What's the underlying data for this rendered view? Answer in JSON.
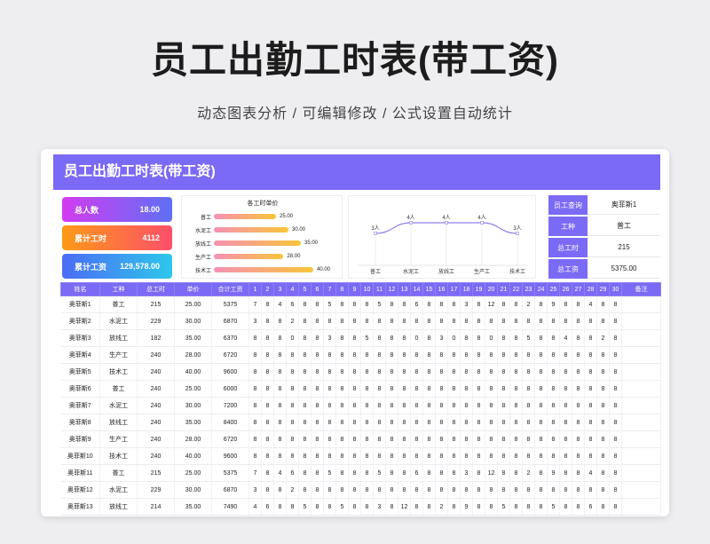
{
  "header": {
    "title": "员工出勤工时表(带工资)",
    "subtitle": "动态图表分析 /  可编辑修改  / 公式设置自动统计"
  },
  "banner": "员工出勤工时表(带工资)",
  "kpis": [
    {
      "label": "总人数",
      "value": "18.00",
      "gradient": [
        "#d33cf0",
        "#5e6ff5"
      ]
    },
    {
      "label": "累计工时",
      "value": "4112",
      "gradient": [
        "#fc9a16",
        "#fc4f6a"
      ]
    },
    {
      "label": "累计工资",
      "value": "129,578.00",
      "gradient": [
        "#4b6cf5",
        "#2ec7eb"
      ]
    }
  ],
  "chart_data": [
    {
      "type": "bar",
      "title": "各工时单价",
      "categories": [
        "普工",
        "水泥工",
        "放线工",
        "生产工",
        "技术工"
      ],
      "values": [
        25,
        30,
        35,
        28,
        40
      ],
      "labels": [
        "25.00",
        "30.00",
        "35.00",
        "28.00",
        "40.00"
      ]
    },
    {
      "type": "line",
      "categories": [
        "普工",
        "水泥工",
        "放线工",
        "生产工",
        "技术工"
      ],
      "values": [
        3,
        4,
        4,
        4,
        3
      ],
      "labels": [
        "3人",
        "4人",
        "4人",
        "4人",
        "3人"
      ],
      "ylim": [
        0,
        5
      ]
    }
  ],
  "info": [
    {
      "k": "员工查询",
      "v": "奥菲斯1"
    },
    {
      "k": "工种",
      "v": "普工"
    },
    {
      "k": "总工时",
      "v": "215"
    },
    {
      "k": "总工资",
      "v": "5375.00"
    }
  ],
  "table": {
    "headers": [
      "姓名",
      "工种",
      "总工时",
      "单价",
      "合计工资",
      "1",
      "2",
      "3",
      "4",
      "5",
      "6",
      "7",
      "8",
      "9",
      "10",
      "11",
      "12",
      "13",
      "14",
      "15",
      "16",
      "17",
      "18",
      "19",
      "20",
      "21",
      "22",
      "23",
      "24",
      "25",
      "26",
      "27",
      "28",
      "29",
      "30",
      "备注"
    ],
    "rows": [
      [
        "奥菲斯1",
        "普工",
        "215",
        "25.00",
        "5375",
        "7",
        "8",
        "4",
        "6",
        "8",
        "8",
        "5",
        "8",
        "8",
        "8",
        "5",
        "8",
        "8",
        "6",
        "8",
        "8",
        "8",
        "3",
        "8",
        "12",
        "8",
        "8",
        "2",
        "8",
        "9",
        "8",
        "8",
        "4",
        "8",
        "8",
        ""
      ],
      [
        "奥菲斯2",
        "水泥工",
        "229",
        "30.00",
        "6870",
        "3",
        "8",
        "8",
        "2",
        "8",
        "8",
        "8",
        "8",
        "8",
        "8",
        "8",
        "8",
        "8",
        "8",
        "8",
        "8",
        "8",
        "8",
        "8",
        "8",
        "8",
        "8",
        "8",
        "8",
        "8",
        "8",
        "8",
        "8",
        "8",
        "8",
        ""
      ],
      [
        "奥菲斯3",
        "放线工",
        "182",
        "35.00",
        "6370",
        "8",
        "8",
        "8",
        "0",
        "8",
        "8",
        "3",
        "8",
        "8",
        "5",
        "8",
        "8",
        "8",
        "0",
        "8",
        "3",
        "0",
        "8",
        "8",
        "0",
        "8",
        "8",
        "5",
        "8",
        "8",
        "4",
        "8",
        "8",
        "2",
        "8",
        ""
      ],
      [
        "奥菲斯4",
        "生产工",
        "240",
        "28.00",
        "6720",
        "8",
        "8",
        "8",
        "8",
        "8",
        "8",
        "8",
        "8",
        "8",
        "8",
        "8",
        "8",
        "8",
        "8",
        "8",
        "8",
        "8",
        "8",
        "8",
        "8",
        "8",
        "8",
        "8",
        "8",
        "8",
        "8",
        "8",
        "8",
        "8",
        "8",
        ""
      ],
      [
        "奥菲斯5",
        "技术工",
        "240",
        "40.00",
        "9600",
        "8",
        "8",
        "8",
        "8",
        "8",
        "8",
        "8",
        "8",
        "8",
        "8",
        "8",
        "8",
        "8",
        "8",
        "8",
        "8",
        "8",
        "8",
        "8",
        "8",
        "8",
        "8",
        "8",
        "8",
        "8",
        "8",
        "8",
        "8",
        "8",
        "8",
        ""
      ],
      [
        "奥菲斯6",
        "普工",
        "240",
        "25.00",
        "6000",
        "8",
        "8",
        "8",
        "8",
        "8",
        "8",
        "8",
        "8",
        "8",
        "8",
        "8",
        "8",
        "8",
        "8",
        "8",
        "8",
        "8",
        "8",
        "8",
        "8",
        "8",
        "8",
        "8",
        "8",
        "8",
        "8",
        "8",
        "8",
        "8",
        "8",
        ""
      ],
      [
        "奥菲斯7",
        "水泥工",
        "240",
        "30.00",
        "7200",
        "8",
        "8",
        "8",
        "8",
        "8",
        "8",
        "8",
        "8",
        "8",
        "8",
        "8",
        "8",
        "8",
        "8",
        "8",
        "8",
        "8",
        "8",
        "8",
        "8",
        "8",
        "8",
        "8",
        "8",
        "8",
        "8",
        "8",
        "8",
        "8",
        "8",
        ""
      ],
      [
        "奥菲斯8",
        "放线工",
        "240",
        "35.00",
        "8400",
        "8",
        "8",
        "8",
        "8",
        "8",
        "8",
        "8",
        "8",
        "8",
        "8",
        "8",
        "8",
        "8",
        "8",
        "8",
        "8",
        "8",
        "8",
        "8",
        "8",
        "8",
        "8",
        "8",
        "8",
        "8",
        "8",
        "8",
        "8",
        "8",
        "8",
        ""
      ],
      [
        "奥菲斯9",
        "生产工",
        "240",
        "28.00",
        "6720",
        "8",
        "8",
        "8",
        "8",
        "8",
        "8",
        "8",
        "8",
        "8",
        "8",
        "8",
        "8",
        "8",
        "8",
        "8",
        "8",
        "8",
        "8",
        "8",
        "8",
        "8",
        "8",
        "8",
        "8",
        "8",
        "8",
        "8",
        "8",
        "8",
        "8",
        ""
      ],
      [
        "奥菲斯10",
        "技术工",
        "240",
        "40.00",
        "9600",
        "8",
        "8",
        "8",
        "8",
        "8",
        "8",
        "8",
        "8",
        "8",
        "8",
        "8",
        "8",
        "8",
        "8",
        "8",
        "8",
        "8",
        "8",
        "8",
        "8",
        "8",
        "8",
        "8",
        "8",
        "8",
        "8",
        "8",
        "8",
        "8",
        "8",
        ""
      ],
      [
        "奥菲斯11",
        "普工",
        "215",
        "25.00",
        "5375",
        "7",
        "8",
        "4",
        "6",
        "8",
        "8",
        "5",
        "8",
        "8",
        "8",
        "5",
        "8",
        "8",
        "6",
        "8",
        "8",
        "8",
        "3",
        "8",
        "12",
        "8",
        "8",
        "2",
        "8",
        "9",
        "8",
        "8",
        "4",
        "8",
        "8",
        ""
      ],
      [
        "奥菲斯12",
        "水泥工",
        "229",
        "30.00",
        "6870",
        "3",
        "8",
        "8",
        "2",
        "8",
        "8",
        "8",
        "8",
        "8",
        "8",
        "8",
        "8",
        "8",
        "8",
        "8",
        "8",
        "8",
        "8",
        "8",
        "8",
        "8",
        "8",
        "8",
        "8",
        "8",
        "8",
        "8",
        "8",
        "8",
        "8",
        ""
      ],
      [
        "奥菲斯13",
        "放线工",
        "214",
        "35.00",
        "7490",
        "4",
        "6",
        "8",
        "8",
        "5",
        "8",
        "8",
        "5",
        "8",
        "8",
        "3",
        "8",
        "12",
        "8",
        "8",
        "2",
        "8",
        "9",
        "8",
        "8",
        "5",
        "8",
        "8",
        "8",
        "5",
        "8",
        "8",
        "6",
        "8",
        "8",
        ""
      ]
    ]
  }
}
